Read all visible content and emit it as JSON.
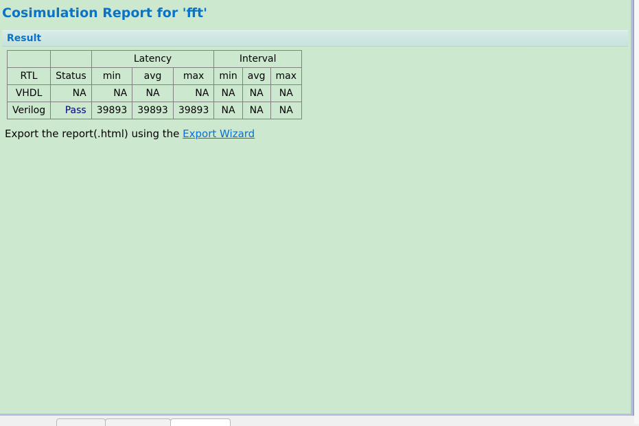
{
  "report": {
    "title": "Cosimulation Report for 'fft'",
    "section_title": "Result"
  },
  "table": {
    "group_headers": {
      "latency": "Latency",
      "interval": "Interval"
    },
    "columns": [
      "RTL",
      "Status",
      "min",
      "avg",
      "max",
      "min",
      "avg",
      "max"
    ],
    "rows": [
      [
        "VHDL",
        "NA",
        "NA",
        "NA",
        "NA",
        "NA",
        "NA",
        "NA"
      ],
      [
        "Verilog",
        "Pass",
        "39893",
        "39893",
        "39893",
        "NA",
        "NA",
        "NA"
      ]
    ]
  },
  "footer": {
    "text": "Export the report(.html) using the ",
    "link_label": "Export Wizard"
  },
  "colors": {
    "background": "#cce8cf",
    "title": "#0a73c8",
    "link": "#0a6fd6",
    "pass_status": "#000080"
  }
}
